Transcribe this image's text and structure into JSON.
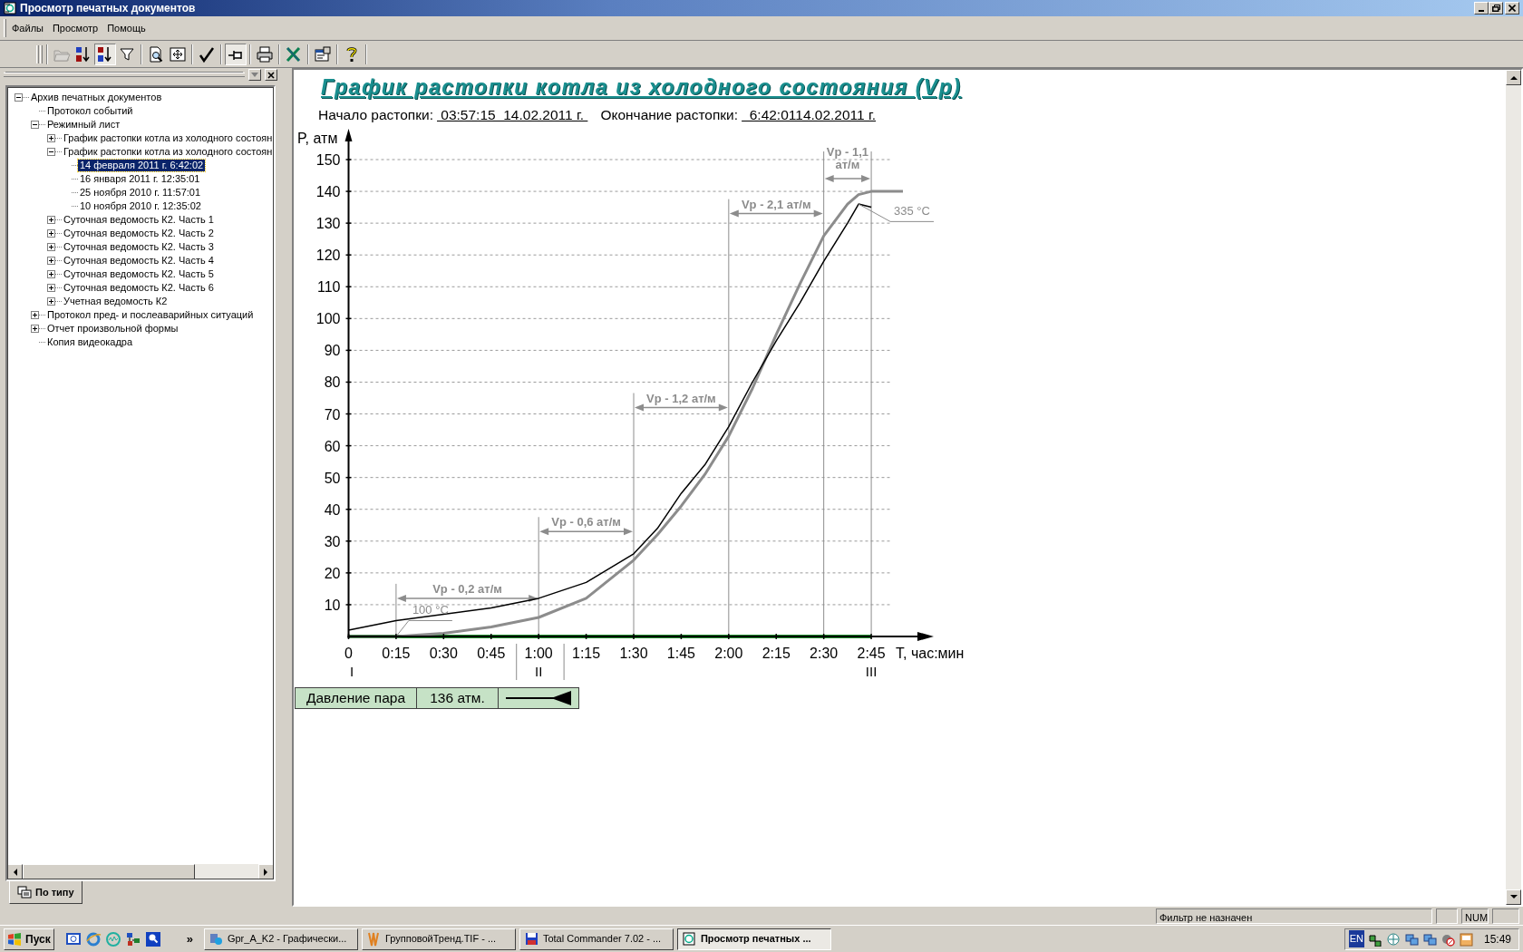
{
  "window": {
    "title": "Просмотр печатных документов"
  },
  "menu": [
    "Файлы",
    "Просмотр",
    "Помощь"
  ],
  "toolbar_groups": [
    [
      {
        "pressed": false,
        "disabled": true
      },
      {
        "pressed": false,
        "disabled": false
      },
      {
        "pressed": true,
        "disabled": false
      },
      {
        "pressed": false,
        "disabled": false
      }
    ],
    [
      {
        "pressed": false,
        "disabled": false
      },
      {
        "pressed": false,
        "disabled": false
      }
    ],
    [
      {
        "pressed": false,
        "disabled": false
      }
    ],
    [
      {
        "pressed": true,
        "disabled": false
      }
    ],
    [
      {
        "pressed": false,
        "disabled": false
      }
    ],
    [
      {
        "pressed": false,
        "disabled": false
      }
    ],
    [
      {
        "pressed": false,
        "disabled": false
      }
    ],
    [
      {
        "pressed": false,
        "disabled": false
      }
    ]
  ],
  "tree": [
    {
      "label": "Архив печатных документов",
      "expanded": true,
      "selected": false,
      "children": [
        {
          "label": "Протокол событий",
          "selected": false
        },
        {
          "label": "Режимный лист",
          "expanded": true,
          "selected": false,
          "children": [
            {
              "label": "График растопки котла из холодного состоян",
              "expanded": false,
              "selected": false
            },
            {
              "label": "График растопки котла из холодного состоян",
              "expanded": true,
              "selected": false,
              "children": [
                {
                  "label": "14 февраля 2011 г. 6:42:02",
                  "selected": true
                },
                {
                  "label": "16 января 2011 г. 12:35:01",
                  "selected": false
                },
                {
                  "label": "25 ноября 2010 г. 11:57:01",
                  "selected": false
                },
                {
                  "label": "10 ноября 2010 г. 12:35:02",
                  "selected": false
                }
              ]
            },
            {
              "label": "Суточная ведомость К2. Часть 1",
              "expanded": false,
              "selected": false
            },
            {
              "label": "Суточная ведомость К2. Часть 2",
              "expanded": false,
              "selected": false
            },
            {
              "label": "Суточная ведомость К2. Часть 3",
              "expanded": false,
              "selected": false
            },
            {
              "label": "Суточная ведомость К2. Часть 4",
              "expanded": false,
              "selected": false
            },
            {
              "label": "Суточная ведомость К2. Часть 5",
              "expanded": false,
              "selected": false
            },
            {
              "label": "Суточная ведомость К2. Часть 6",
              "expanded": false,
              "selected": false
            },
            {
              "label": "Учетная ведомость К2",
              "expanded": false,
              "selected": false
            }
          ]
        },
        {
          "label": "Протокол пред- и послеаварийных ситуаций",
          "expanded": false,
          "selected": false
        },
        {
          "label": "Отчет произвольной формы",
          "expanded": false,
          "selected": false
        },
        {
          "label": "Копия видеокадра",
          "selected": false
        }
      ]
    }
  ],
  "panel_tabs": [
    {
      "label": "По типу",
      "selected": true
    }
  ],
  "content": {
    "title": "График растопки котла из холодного состояния (Vp)",
    "start_label": "Начало растопки:",
    "start_value": " 03:57:15  14.02.2011 г. ",
    "end_label": "Окончание растопки:",
    "end_value": "  6:42:0114.02.2011 г.",
    "chart_data": {
      "type": "line",
      "ylabel": "P, атм",
      "xlabel": "Т, час:мин",
      "grid": true,
      "x": [
        0,
        15,
        30,
        45,
        60,
        75,
        90,
        97.5,
        105,
        112.5,
        120,
        127.5,
        135,
        142.5,
        150,
        157.5,
        161,
        165,
        175
      ],
      "xlim": [
        0,
        180
      ],
      "ylim": [
        0,
        150
      ],
      "xticks": [
        {
          "value": 0,
          "label": "0"
        },
        {
          "value": 15,
          "label": "0:15"
        },
        {
          "value": 30,
          "label": "0:30"
        },
        {
          "value": 45,
          "label": "0:45"
        },
        {
          "value": 60,
          "label": "1:00"
        },
        {
          "value": 75,
          "label": "1:15"
        },
        {
          "value": 90,
          "label": "1:30"
        },
        {
          "value": 105,
          "label": "1:45"
        },
        {
          "value": 120,
          "label": "2:00"
        },
        {
          "value": 135,
          "label": "2:15"
        },
        {
          "value": 150,
          "label": "2:30"
        },
        {
          "value": 165,
          "label": "2:45"
        }
      ],
      "yticks": [
        10,
        20,
        30,
        40,
        50,
        60,
        70,
        80,
        90,
        100,
        110,
        120,
        130,
        140,
        150
      ],
      "series": [
        {
          "color": "#8c8c8c",
          "values": [
            0,
            0,
            1,
            3,
            6,
            12,
            24,
            32,
            41,
            51,
            63,
            78,
            95,
            111,
            126,
            136,
            139,
            140,
            140
          ]
        },
        {
          "color": "#000000",
          "values": [
            2,
            5,
            7,
            9,
            12,
            17,
            26,
            34,
            45,
            54,
            66,
            80,
            93,
            105,
            118,
            130,
            136,
            135,
            null
          ]
        }
      ],
      "ref_lines": [
        {
          "axis": "x",
          "value": 15
        },
        {
          "axis": "x",
          "value": 60
        },
        {
          "axis": "x",
          "value": 90
        },
        {
          "axis": "x",
          "value": 120
        },
        {
          "axis": "x",
          "value": 150
        },
        {
          "axis": "x",
          "value": 165
        }
      ],
      "annotations": [
        "Vp - 0,2 ат/м",
        "Vp - 0,6 ат/м",
        "Vp - 1,2 ат/м",
        "Vp - 2,1 ат/м",
        "Vp - 1,1 ат/м",
        "100 °C",
        "335 °C"
      ]
    },
    "stage_labels": [
      "I",
      "II",
      "III"
    ],
    "legend": {
      "label": "Давление пара",
      "value": "136 атм."
    }
  },
  "status_bar": {
    "filter": "Фильтр не назначен",
    "num": "NUM"
  },
  "taskbar": {
    "start": "Пуск",
    "more": "»",
    "tasks": [
      {
        "label": "Gpr_A_K2 - Графически...",
        "selected": false
      },
      {
        "label": "ГрупповойТренд.TIF - ...",
        "selected": false
      },
      {
        "label": "Total Commander 7.02 - ...",
        "selected": false
      },
      {
        "label": "Просмотр печатных ...",
        "selected": true
      }
    ],
    "language": "EN",
    "clock": "15:49"
  }
}
